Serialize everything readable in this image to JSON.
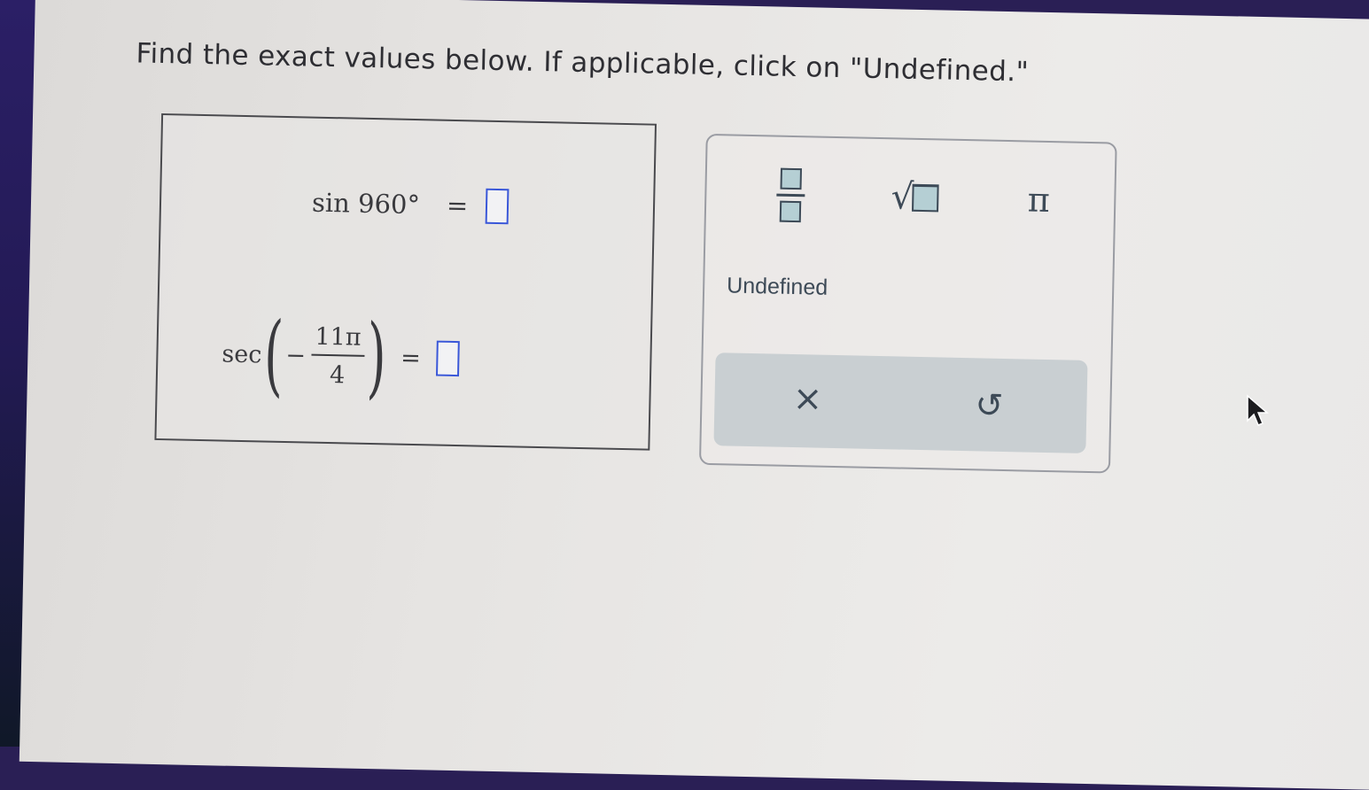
{
  "instruction": "Find the exact values below. If applicable, click on \"Undefined.\"",
  "questions": {
    "q1": {
      "expression": "sin 960°",
      "equals": "="
    },
    "q2": {
      "function": "sec",
      "sign": "−",
      "numerator": "11π",
      "denominator": "4",
      "equals": "="
    }
  },
  "palette": {
    "fraction_icon": "fraction-template-icon",
    "sqrt_icon": "square-root-template-icon",
    "sqrt_symbol": "√",
    "pi_label": "π",
    "undefined_label": "Undefined",
    "clear_symbol": "×",
    "undo_symbol": "↺"
  },
  "colors": {
    "answer_box_border": "#3a57d8",
    "icon_fill": "#b5cfd4",
    "action_bar": "#c9cfd2"
  }
}
